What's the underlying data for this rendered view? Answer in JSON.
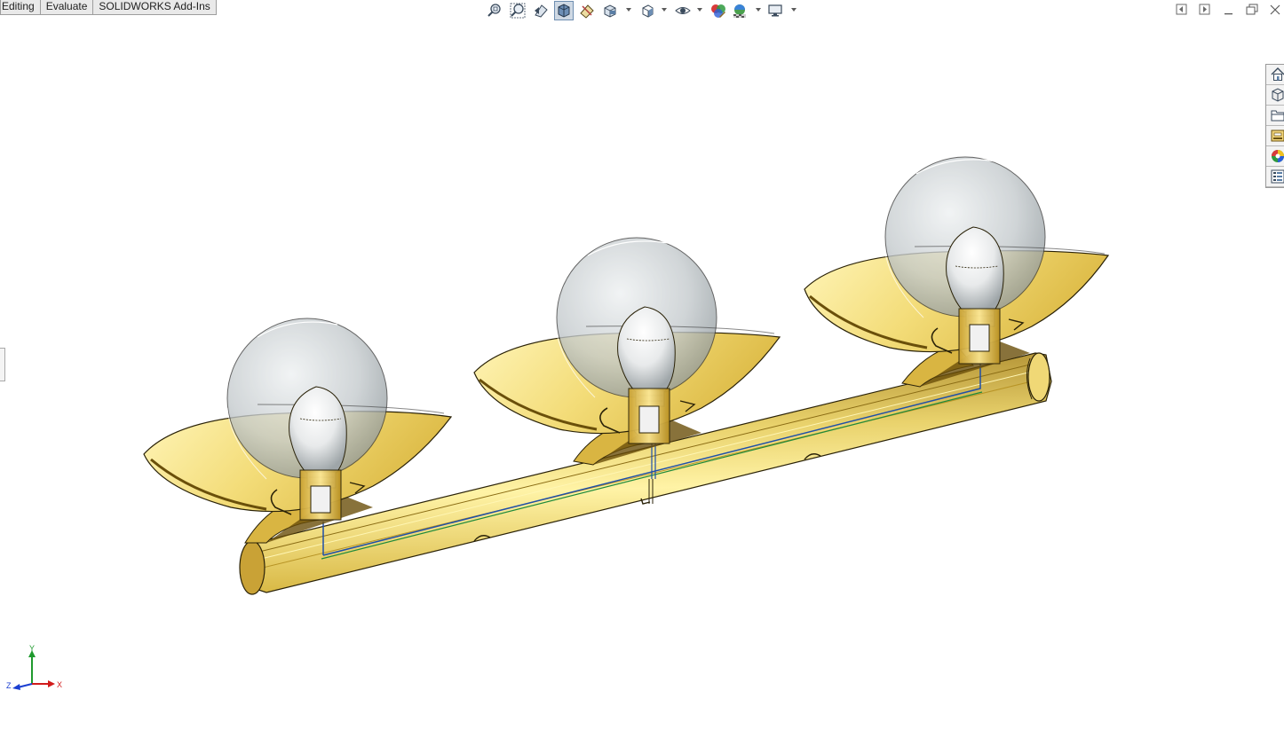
{
  "command_manager": {
    "tabs": [
      {
        "label": "Editing"
      },
      {
        "label": "Evaluate"
      },
      {
        "label": "SOLIDWORKS Add-Ins"
      }
    ]
  },
  "heads_up_toolbar": {
    "items": [
      {
        "icon": "zoom-to-fit-icon"
      },
      {
        "icon": "zoom-to-area-icon"
      },
      {
        "icon": "previous-view-icon"
      },
      {
        "icon": "section-view-icon",
        "active": true
      },
      {
        "icon": "dynamic-annotation-views-icon"
      },
      {
        "icon": "view-orientation-icon",
        "dropdown": true
      },
      {
        "icon": "display-style-icon",
        "dropdown": true
      },
      {
        "icon": "hide-show-items-icon",
        "dropdown": true
      },
      {
        "icon": "edit-appearance-icon"
      },
      {
        "icon": "apply-scene-icon",
        "dropdown": true
      },
      {
        "icon": "view-settings-icon",
        "dropdown": true
      }
    ]
  },
  "window_controls": [
    "tile-left-icon",
    "tile-right-icon",
    "minimize-icon",
    "restore-icon",
    "close-icon"
  ],
  "task_pane": {
    "tabs": [
      "home-icon",
      "resources-icon",
      "design-library-icon",
      "file-explorer-icon",
      "appearances-scenes-icon",
      "custom-properties-icon"
    ]
  },
  "reference_triad": {
    "x_label": "X",
    "y_label": "Y",
    "z_label": "Z"
  },
  "colors": {
    "model_brass_light": "#f4e79a",
    "model_brass": "#d9b542",
    "model_brass_dark": "#8a6a12",
    "bulb_glass": "#c8cdd0",
    "wire_blue": "#1f4fa8",
    "wire_green": "#1f8a3a",
    "axis_x": "#d11b1b",
    "axis_y": "#1f9a2e",
    "axis_z": "#1b3fd1"
  }
}
